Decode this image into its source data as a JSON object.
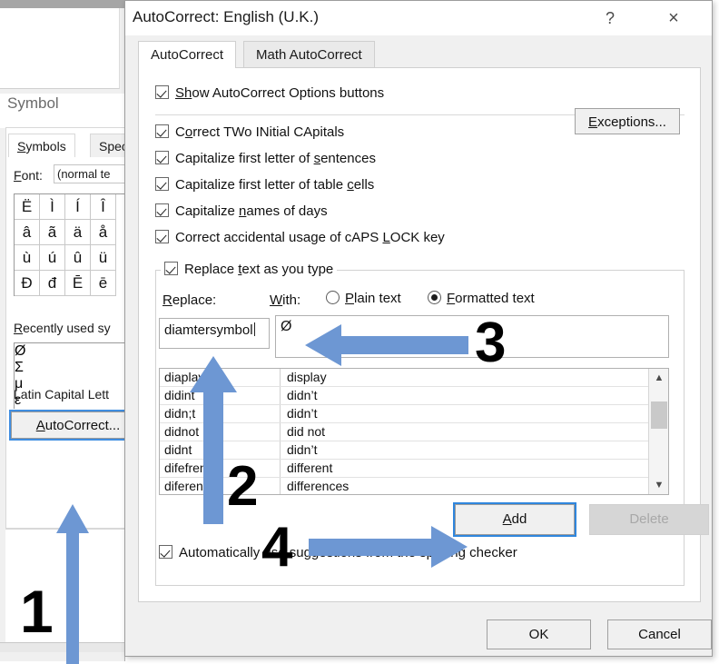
{
  "symbol_dialog": {
    "title": "Symbol",
    "tabs": [
      {
        "label": "Symbols",
        "active": true
      },
      {
        "label": "Spec",
        "active": false
      }
    ],
    "font_label": "Font:",
    "font_value": "(normal te",
    "grid_rows": [
      [
        "Ë",
        "Ì",
        "Í",
        "Î"
      ],
      [
        "â",
        "ã",
        "ä",
        "å"
      ],
      [
        "ù",
        "ú",
        "û",
        "ü"
      ],
      [
        "Đ",
        "đ",
        "Ē",
        "ē"
      ]
    ],
    "recent_label": "Recently used sy",
    "recent_symbols": [
      "Ø",
      "Σ",
      "μ",
      "ε"
    ],
    "char_name": "Latin Capital Lett",
    "autocorrect_button": "AutoCorrect..."
  },
  "autocorrect_dialog": {
    "title": "AutoCorrect: English (U.K.)",
    "help_icon": "?",
    "close_icon": "×",
    "tabs": [
      {
        "label": "AutoCorrect",
        "active": true
      },
      {
        "label": "Math AutoCorrect",
        "active": false
      }
    ],
    "checkboxes": [
      {
        "label": "Show AutoCorrect Options buttons",
        "checked": true
      },
      {
        "label": "Correct TWo INitial CApitals",
        "checked": true
      },
      {
        "label": "Capitalize first letter of sentences",
        "checked": true
      },
      {
        "label": "Capitalize first letter of table cells",
        "checked": true
      },
      {
        "label": "Capitalize names of days",
        "checked": true
      },
      {
        "label": "Correct accidental usage of cAPS LOCK key",
        "checked": true
      }
    ],
    "exceptions_button": "Exceptions...",
    "replace_section": {
      "checkbox_label": "Replace text as you type",
      "checkbox_checked": true,
      "replace_label": "Replace:",
      "with_label": "With:",
      "radio_plain": "Plain text",
      "radio_formatted": "Formatted text",
      "selected_radio": "Formatted text",
      "replace_value": "diamtersymbol",
      "with_value": "Ø",
      "entries": [
        {
          "replace": "diaplay",
          "with": "display"
        },
        {
          "replace": "didint",
          "with": "didn’t"
        },
        {
          "replace": "didn;t",
          "with": "didn’t"
        },
        {
          "replace": "didnot",
          "with": "did not"
        },
        {
          "replace": "didnt",
          "with": "didn’t"
        },
        {
          "replace": "difefrent",
          "with": "different"
        },
        {
          "replace": "diferences",
          "with": "differences"
        }
      ],
      "add_button": "Add",
      "delete_button": "Delete",
      "delete_disabled": true,
      "spelling_checkbox_label": "Automatically use suggestions from the spelling checker",
      "spelling_checkbox_checked": true
    },
    "footer": {
      "ok_button": "OK",
      "cancel_button": "Cancel"
    }
  },
  "annotations": {
    "arrow_color": "#6d97d3",
    "steps": [
      {
        "number": "1",
        "target": "autocorrect-button"
      },
      {
        "number": "2",
        "target": "autocorrect-entries-list"
      },
      {
        "number": "3",
        "target": "with-field"
      },
      {
        "number": "4",
        "target": "add-button"
      }
    ]
  }
}
